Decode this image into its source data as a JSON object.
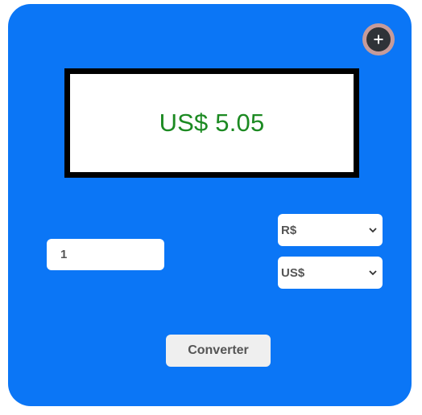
{
  "display": {
    "result_text": "US$ 5.05"
  },
  "add_button": {
    "icon": "plus-icon"
  },
  "amount": {
    "value": "1"
  },
  "from_currency": {
    "selected": "R$",
    "icon": "chevron-down-icon"
  },
  "to_currency": {
    "selected": "US$",
    "icon": "chevron-down-icon"
  },
  "convert_button": {
    "label": "Converter"
  },
  "colors": {
    "card_background": "#0b76f6",
    "result_text": "#1c8a22",
    "display_border": "#000000"
  }
}
